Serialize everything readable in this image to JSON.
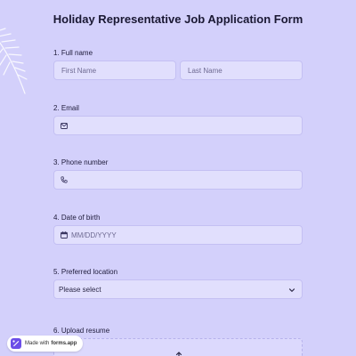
{
  "form": {
    "title": "Holiday Representative Job Application Form"
  },
  "questions": {
    "full_name": {
      "label": "1.  Full name",
      "first_placeholder": "First Name",
      "last_placeholder": "Last Name"
    },
    "email": {
      "label": "2.  Email",
      "icon": "envelope-icon"
    },
    "phone": {
      "label": "3.  Phone number",
      "icon": "phone-icon"
    },
    "dob": {
      "label": "4.  Date of birth",
      "placeholder": "MM/DD/YYYY",
      "icon": "calendar-icon"
    },
    "location": {
      "label": "5.  Preferred location",
      "selected": "Please select",
      "icon": "chevron-down-icon"
    },
    "resume": {
      "label": "6.  Upload resume"
    }
  },
  "badge": {
    "prefix": "Made with",
    "brand": "forms.app"
  },
  "colors": {
    "background": "#d3d0fb",
    "field_bg": "#e1dffd",
    "field_border": "#c4c0f3",
    "badge_accent": "#6c4ee8"
  }
}
